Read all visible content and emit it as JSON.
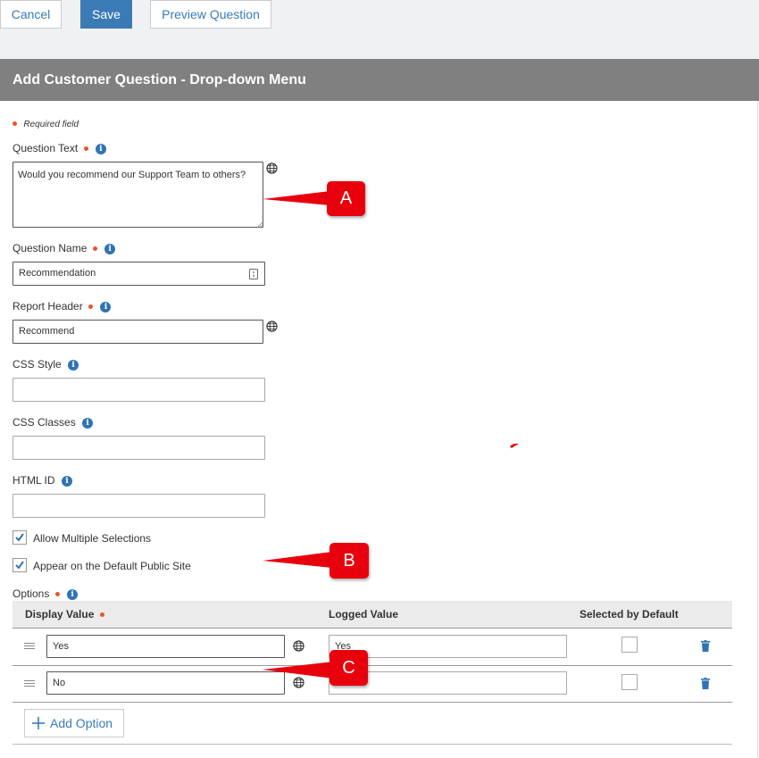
{
  "toolbar": {
    "cancel_label": "Cancel",
    "save_label": "Save",
    "preview_label": "Preview Question"
  },
  "header": {
    "title": "Add Customer Question - Drop-down Menu"
  },
  "form": {
    "required_note": "Required field",
    "question_text": {
      "label": "Question Text",
      "value": "Would you recommend our Support Team to others?"
    },
    "question_name": {
      "label": "Question Name",
      "value": "Recommendation"
    },
    "report_header": {
      "label": "Report Header",
      "value": "Recommend"
    },
    "css_style": {
      "label": "CSS Style",
      "value": ""
    },
    "css_classes": {
      "label": "CSS Classes",
      "value": ""
    },
    "html_id": {
      "label": "HTML ID",
      "value": ""
    },
    "allow_multiple": {
      "label": "Allow Multiple Selections",
      "checked": true
    },
    "appear_default": {
      "label": "Appear on the Default Public Site",
      "checked": true
    },
    "options_label": "Options"
  },
  "options_table": {
    "columns": [
      "Display Value",
      "Logged Value",
      "Selected by Default"
    ],
    "rows": [
      {
        "display": "Yes",
        "logged": "Yes",
        "selected": false
      },
      {
        "display": "No",
        "logged": "",
        "selected": false
      }
    ],
    "add_label": "Add Option"
  },
  "callouts": {
    "a": "A",
    "b": "B",
    "c": "C"
  },
  "colors": {
    "accent": "#3a7bb5",
    "header_bg": "#808080",
    "required": "#e8562a",
    "callout": "#e8000d"
  },
  "icons": {
    "info": "info-icon",
    "globe": "globe-icon",
    "drag": "drag-handle-icon",
    "delete": "trash-icon",
    "add": "plus-icon",
    "check": "checkmark-icon"
  }
}
